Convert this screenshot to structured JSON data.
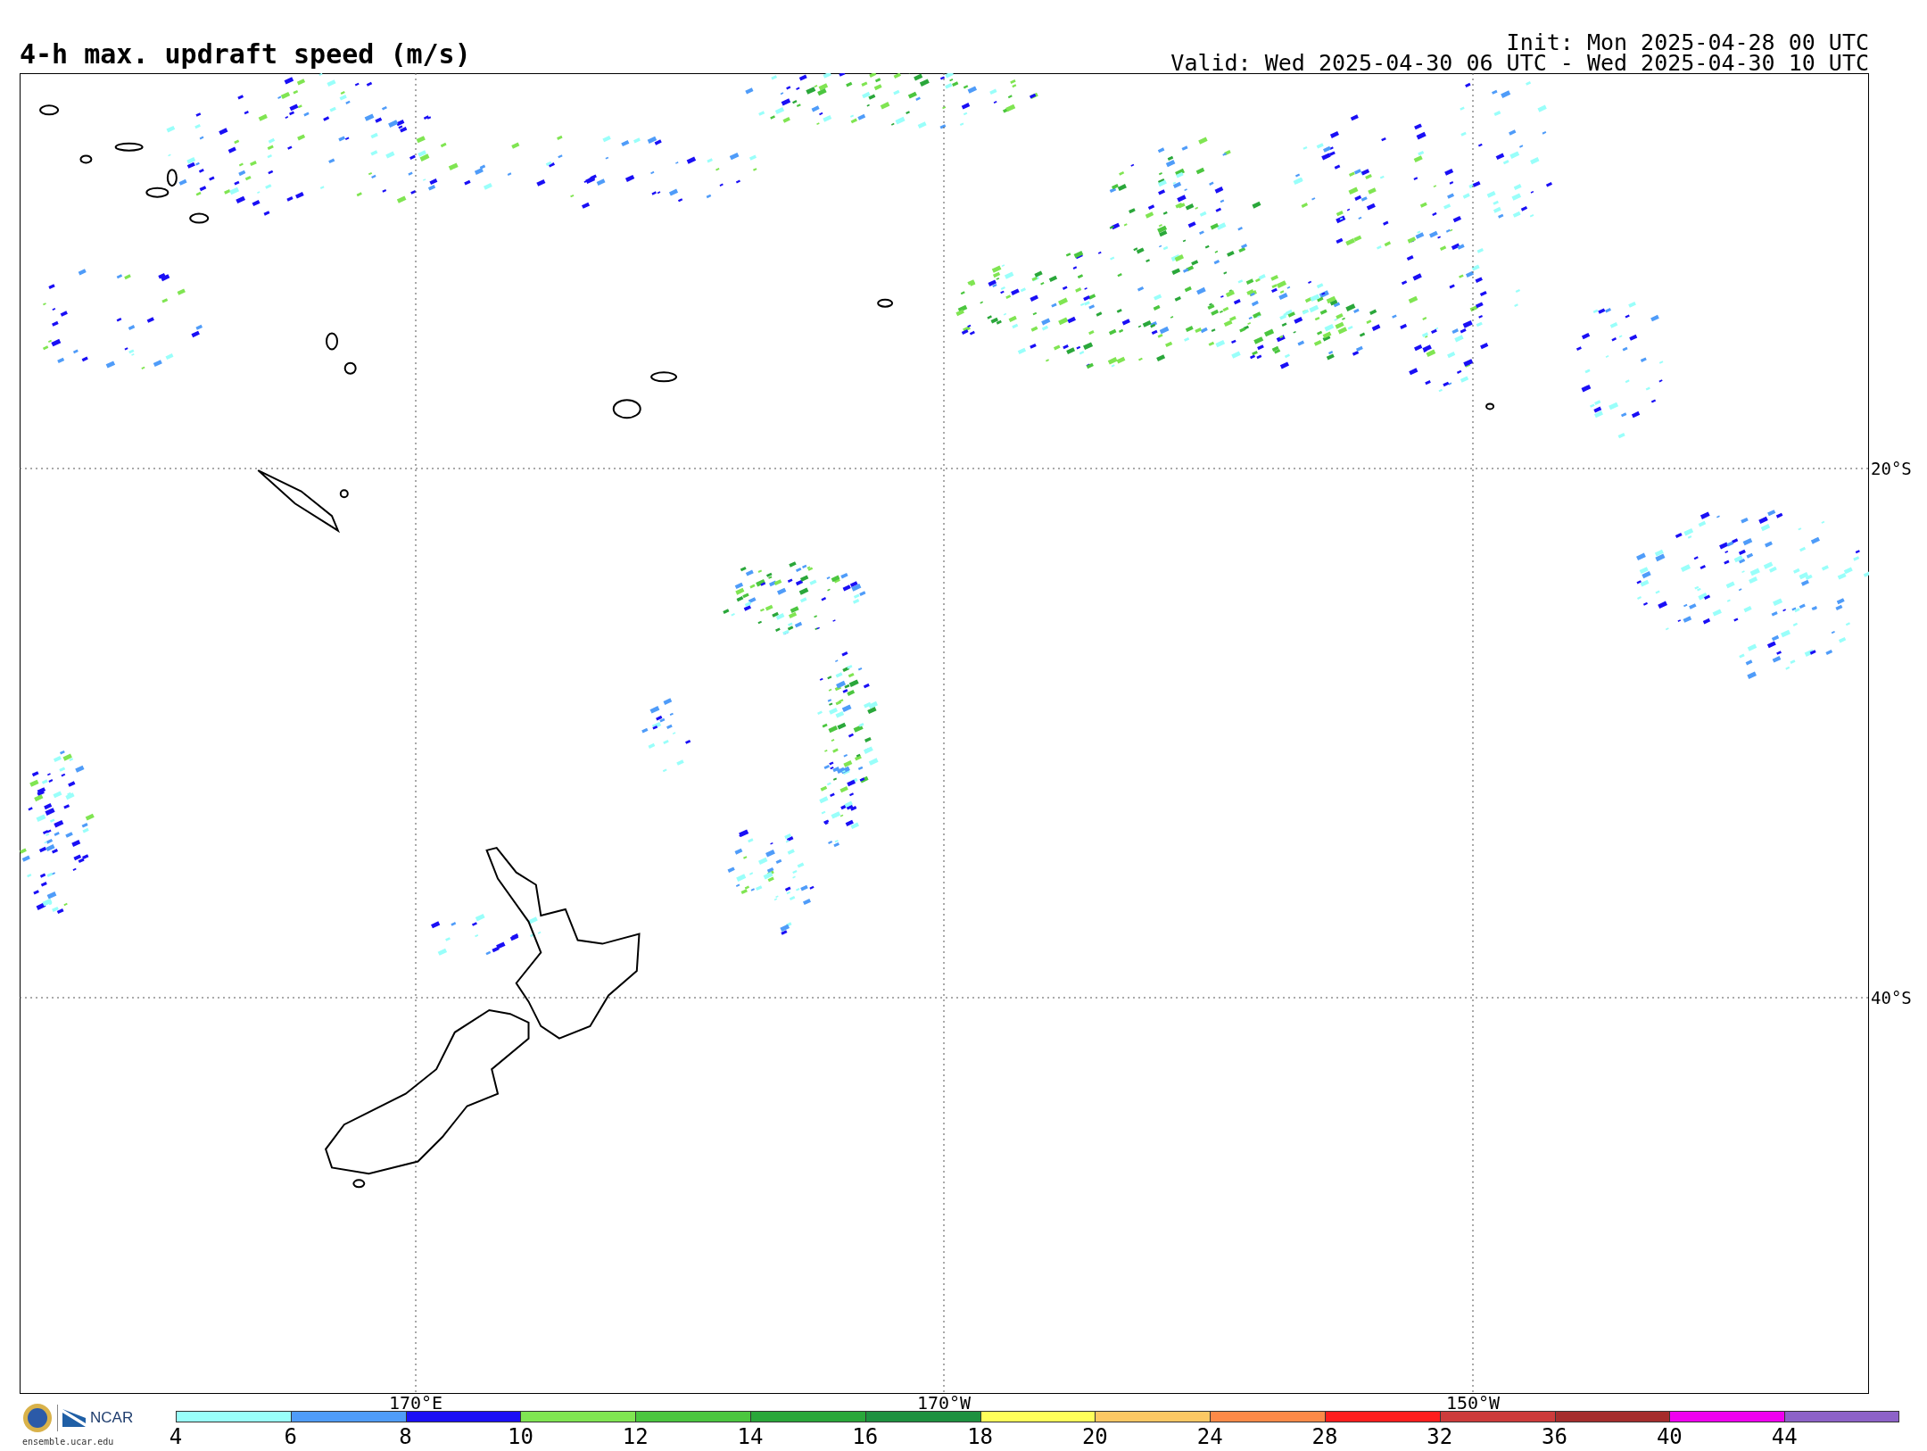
{
  "title": "4-h max. updraft speed (m/s)",
  "init": "Init: Mon 2025-04-28 00 UTC",
  "valid": "Valid: Wed 2025-04-30 06 UTC - Wed 2025-04-30 10 UTC",
  "map": {
    "longitude_labels": [
      "170°E",
      "170°W",
      "150°W"
    ],
    "latitude_labels": [
      "20°S",
      "40°S"
    ]
  },
  "logo": {
    "name": "NCAR",
    "site": "ensemble.ucar.edu"
  },
  "colorbar": [
    {
      "label": "4",
      "color": "#99fffa"
    },
    {
      "label": "6",
      "color": "#4f9cf9"
    },
    {
      "label": "8",
      "color": "#1a0ff5"
    },
    {
      "label": "10",
      "color": "#80e552"
    },
    {
      "label": "12",
      "color": "#4bc63f"
    },
    {
      "label": "14",
      "color": "#2aa73a"
    },
    {
      "label": "16",
      "color": "#1e9140"
    },
    {
      "label": "18",
      "color": "#ffff5a"
    },
    {
      "label": "20",
      "color": "#fcc864"
    },
    {
      "label": "24",
      "color": "#fd8a48"
    },
    {
      "label": "28",
      "color": "#fe1e1e"
    },
    {
      "label": "32",
      "color": "#cd3b3b"
    },
    {
      "label": "36",
      "color": "#a52c2c"
    },
    {
      "label": "40",
      "color": "#ef00ef"
    },
    {
      "label": "44",
      "color": "#8d62c8"
    }
  ]
}
